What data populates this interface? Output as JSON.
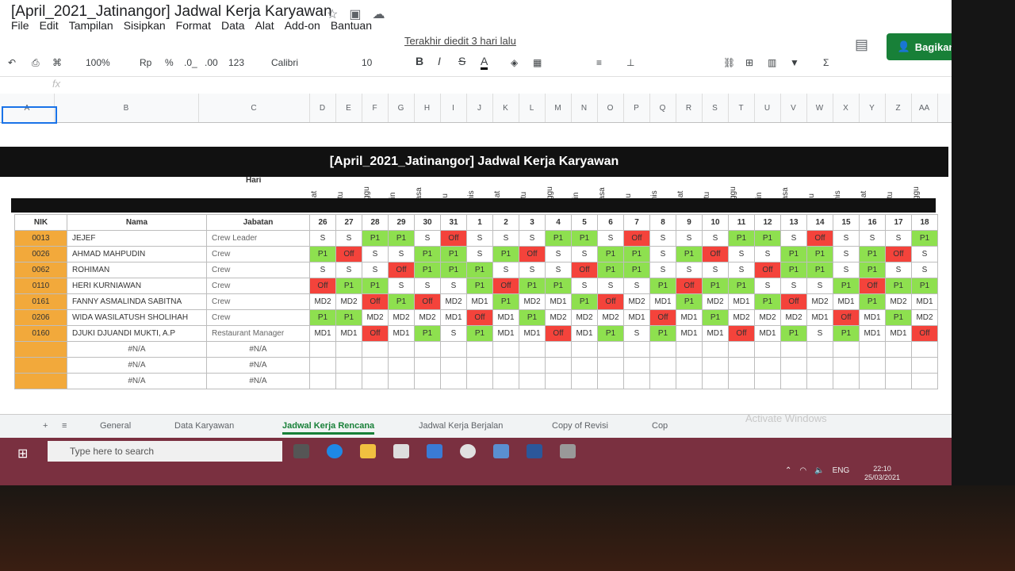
{
  "app": {
    "title": "[April_2021_Jatinangor] Jadwal Kerja Karyawan",
    "menu": [
      "File",
      "Edit",
      "Tampilan",
      "Sisipkan",
      "Format",
      "Data",
      "Alat",
      "Add-on",
      "Bantuan"
    ],
    "last_edit": "Terakhir diedit 3 hari lalu",
    "share_label": "Bagikan"
  },
  "toolbar": {
    "zoom": "100%",
    "currency": "Rp",
    "percent": "%",
    "dec_less": ".0_",
    ".dec_more": ".00",
    "number_format": "123",
    "font": "Calibri",
    "size": "10",
    "bold": "B",
    "italic": "I",
    "strike": "S",
    "text_color": "A"
  },
  "formula_bar": {
    "fx": "fx"
  },
  "columns": [
    "A",
    "B",
    "C",
    "D",
    "E",
    "F",
    "G",
    "H",
    "I",
    "J",
    "K",
    "L",
    "M",
    "N",
    "O",
    "P",
    "Q",
    "R",
    "S",
    "T",
    "U",
    "V",
    "W",
    "X",
    "Y",
    "Z",
    "AA"
  ],
  "sheet": {
    "banner": "[April_2021_Jatinangor] Jadwal Kerja Karyawan",
    "hari_label": "Hari",
    "headers": {
      "nik": "NIK",
      "nama": "Nama",
      "jabatan": "Jabatan"
    },
    "day_names": [
      "Jumat",
      "Sabtu",
      "Minggu",
      "Senin",
      "SElasa",
      "Rabu",
      "Kamis",
      "Jumat",
      "Sabtu",
      "Minggu",
      "Senin",
      "SElasa",
      "Rabu",
      "Kamis",
      "Jumat",
      "Sabtu",
      "Minggu",
      "Senin",
      "SElasa",
      "Rabu",
      "Kamis",
      "Jumat",
      "Sabtu",
      "Minggu"
    ],
    "dates": [
      "26",
      "27",
      "28",
      "29",
      "30",
      "31",
      "1",
      "2",
      "3",
      "4",
      "5",
      "6",
      "7",
      "8",
      "9",
      "10",
      "11",
      "12",
      "13",
      "14",
      "15",
      "16",
      "17",
      "18"
    ],
    "rows": [
      {
        "nik": "0013",
        "nama": "JEJEF",
        "jabatan": "Crew Leader",
        "shifts": [
          "S",
          "S",
          "P1",
          "P1",
          "S",
          "Off",
          "S",
          "S",
          "S",
          "P1",
          "P1",
          "S",
          "Off",
          "S",
          "S",
          "S",
          "P1",
          "P1",
          "S",
          "Off",
          "S",
          "S",
          "S",
          "P1"
        ]
      },
      {
        "nik": "0026",
        "nama": "AHMAD MAHPUDIN",
        "jabatan": "Crew",
        "shifts": [
          "P1",
          "Off",
          "S",
          "S",
          "P1",
          "P1",
          "S",
          "P1",
          "Off",
          "S",
          "S",
          "P1",
          "P1",
          "S",
          "P1",
          "Off",
          "S",
          "S",
          "P1",
          "P1",
          "S",
          "P1",
          "Off",
          "S"
        ]
      },
      {
        "nik": "0062",
        "nama": "ROHIMAN",
        "jabatan": "Crew",
        "shifts": [
          "S",
          "S",
          "S",
          "Off",
          "P1",
          "P1",
          "P1",
          "S",
          "S",
          "S",
          "Off",
          "P1",
          "P1",
          "S",
          "S",
          "S",
          "S",
          "Off",
          "P1",
          "P1",
          "S",
          "P1",
          "S",
          "S"
        ]
      },
      {
        "nik": "0110",
        "nama": "HERI KURNIAWAN",
        "jabatan": "Crew",
        "shifts": [
          "Off",
          "P1",
          "P1",
          "S",
          "S",
          "S",
          "P1",
          "Off",
          "P1",
          "P1",
          "S",
          "S",
          "S",
          "P1",
          "Off",
          "P1",
          "P1",
          "S",
          "S",
          "S",
          "P1",
          "Off",
          "P1",
          "P1"
        ]
      },
      {
        "nik": "0161",
        "nama": "FANNY ASMALINDA SABITNA",
        "jabatan": "Crew",
        "shifts": [
          "MD2",
          "MD2",
          "Off",
          "P1",
          "Off",
          "MD2",
          "MD1",
          "P1",
          "MD2",
          "MD1",
          "P1",
          "Off",
          "MD2",
          "MD1",
          "P1",
          "MD2",
          "MD1",
          "P1",
          "Off",
          "MD2",
          "MD1",
          "P1",
          "MD2",
          "MD1"
        ]
      },
      {
        "nik": "0206",
        "nama": "WIDA WASILATUSH SHOLIHAH",
        "jabatan": "Crew",
        "shifts": [
          "P1",
          "P1",
          "MD2",
          "MD2",
          "MD2",
          "MD1",
          "Off",
          "MD1",
          "P1",
          "MD2",
          "MD2",
          "MD2",
          "MD1",
          "Off",
          "MD1",
          "P1",
          "MD2",
          "MD2",
          "MD2",
          "MD1",
          "Off",
          "MD1",
          "P1",
          "MD2"
        ]
      },
      {
        "nik": "0160",
        "nama": "DJUKI DJUANDI MUKTI, A.P",
        "jabatan": "Restaurant Manager",
        "shifts": [
          "MD1",
          "MD1",
          "Off",
          "MD1",
          "P1",
          "S",
          "P1",
          "MD1",
          "MD1",
          "Off",
          "MD1",
          "P1",
          "S",
          "P1",
          "MD1",
          "MD1",
          "Off",
          "MD1",
          "P1",
          "S",
          "P1",
          "MD1",
          "MD1",
          "Off"
        ]
      },
      {
        "nik": "",
        "nama": "#N/A",
        "jabatan": "#N/A",
        "shifts": []
      },
      {
        "nik": "",
        "nama": "#N/A",
        "jabatan": "#N/A",
        "shifts": []
      },
      {
        "nik": "",
        "nama": "#N/A",
        "jabatan": "#N/A",
        "shifts": []
      }
    ]
  },
  "sheet_tabs": [
    "General",
    "Data Karyawan",
    "Jadwal Kerja Rencana",
    "Jadwal Kerja Berjalan",
    "Copy of Revisi",
    "Cop"
  ],
  "activate_text": "Activate Windows",
  "taskbar": {
    "search_placeholder": "Type here to search",
    "language": "ENG",
    "time": "22:10",
    "date": "25/03/2021"
  },
  "colors": {
    "accent": "#188038",
    "p1": "#8ee04f",
    "off": "#f4433b",
    "nik": "#f2a93b"
  }
}
